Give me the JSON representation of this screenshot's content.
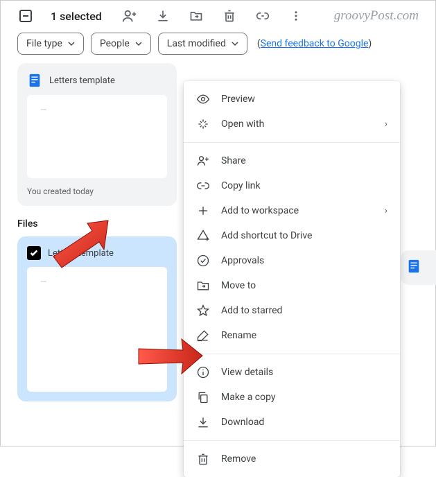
{
  "toolbar": {
    "selected_text": "1 selected"
  },
  "watermark": "groovyPost.com",
  "chips": {
    "file_type": "File type",
    "people": "People",
    "last_modified": "Last modified"
  },
  "feedback": {
    "open": "(",
    "link": "Send feedback to Google",
    "close": ")"
  },
  "suggested_card": {
    "title": "Letters template",
    "footer": "You created today"
  },
  "section_files_label": "Files",
  "selected_card": {
    "title": "Letters template"
  },
  "context_menu": {
    "preview": "Preview",
    "open_with": "Open with",
    "share": "Share",
    "copy_link": "Copy link",
    "add_to_workspace": "Add to workspace",
    "add_shortcut": "Add shortcut to Drive",
    "approvals": "Approvals",
    "move_to": "Move to",
    "add_to_starred": "Add to starred",
    "rename": "Rename",
    "view_details": "View details",
    "make_a_copy": "Make a copy",
    "download": "Download",
    "remove": "Remove"
  }
}
